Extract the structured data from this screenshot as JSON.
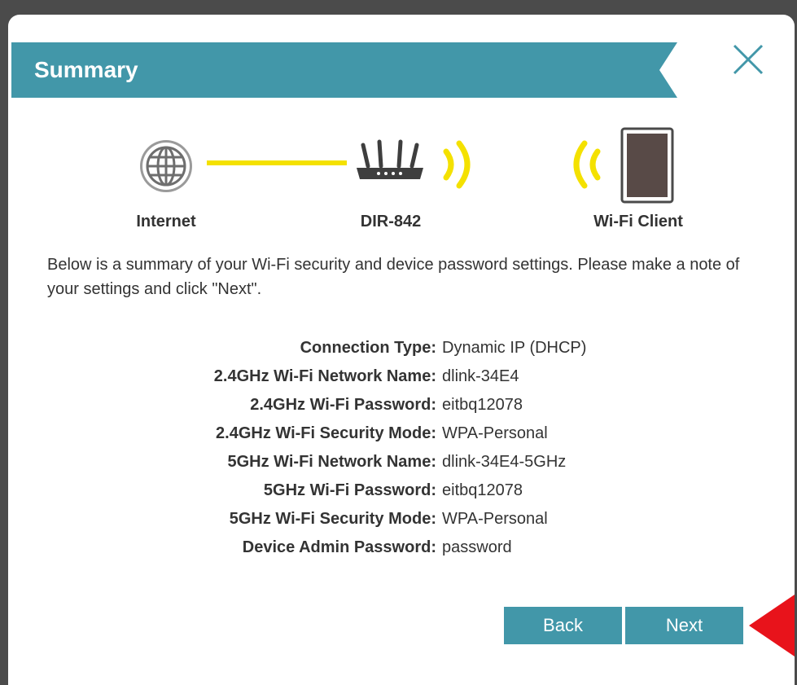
{
  "header": {
    "title": "Summary",
    "banner_color": "#4297a9"
  },
  "close_icon": "close-x-icon",
  "diagram": {
    "internet_label": "Internet",
    "router_label": "DIR-842",
    "client_label": "Wi-Fi Client",
    "link_color": "#f4e100",
    "signal_color": "#f4e100"
  },
  "intro": "Below is a summary of your Wi-Fi security and device password settings. Please make a note of your settings and click \"Next\".",
  "summary": [
    {
      "key": "Connection Type:",
      "value": "Dynamic IP (DHCP)"
    },
    {
      "key": "2.4GHz Wi-Fi Network Name:",
      "value": "dlink-34E4"
    },
    {
      "key": "2.4GHz Wi-Fi Password:",
      "value": "eitbq12078"
    },
    {
      "key": "2.4GHz Wi-Fi Security Mode:",
      "value": "WPA-Personal"
    },
    {
      "key": "5GHz Wi-Fi Network Name:",
      "value": "dlink-34E4-5GHz"
    },
    {
      "key": "5GHz Wi-Fi Password:",
      "value": "eitbq12078"
    },
    {
      "key": "5GHz Wi-Fi Security Mode:",
      "value": "WPA-Personal"
    },
    {
      "key": "Device Admin Password:",
      "value": "password"
    }
  ],
  "buttons": {
    "back": "Back",
    "next": "Next",
    "color": "#4297a9"
  },
  "annotation_arrow_color": "#e8131b"
}
